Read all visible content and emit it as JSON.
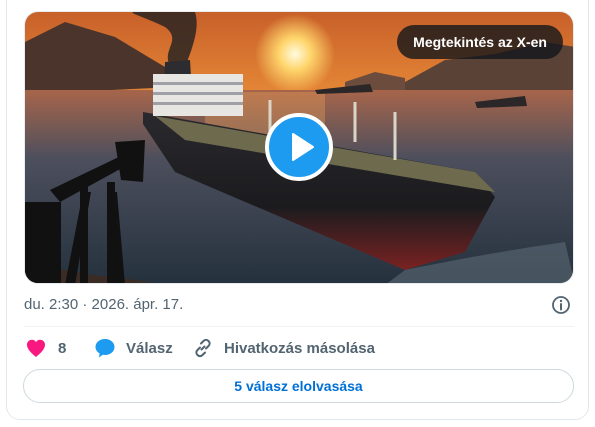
{
  "media": {
    "view_on_x_label": "Megtekintés az X-en"
  },
  "tweet": {
    "timestamp": "du. 2:30 · 2026. ápr. 17."
  },
  "actions": {
    "like_count": "8",
    "reply_label": "Válasz",
    "copy_link_label": "Hivatkozás másolása"
  },
  "read_replies_label": "5 válasz elolvasása",
  "colors": {
    "accent": "#1d9bf0",
    "like": "#f91880",
    "link_text": "#006fd6",
    "muted_text": "#536471"
  },
  "icons": {
    "play": "play-icon",
    "info": "info-icon",
    "like": "heart-icon",
    "reply": "speech-bubble-icon",
    "copy_link": "link-icon"
  }
}
